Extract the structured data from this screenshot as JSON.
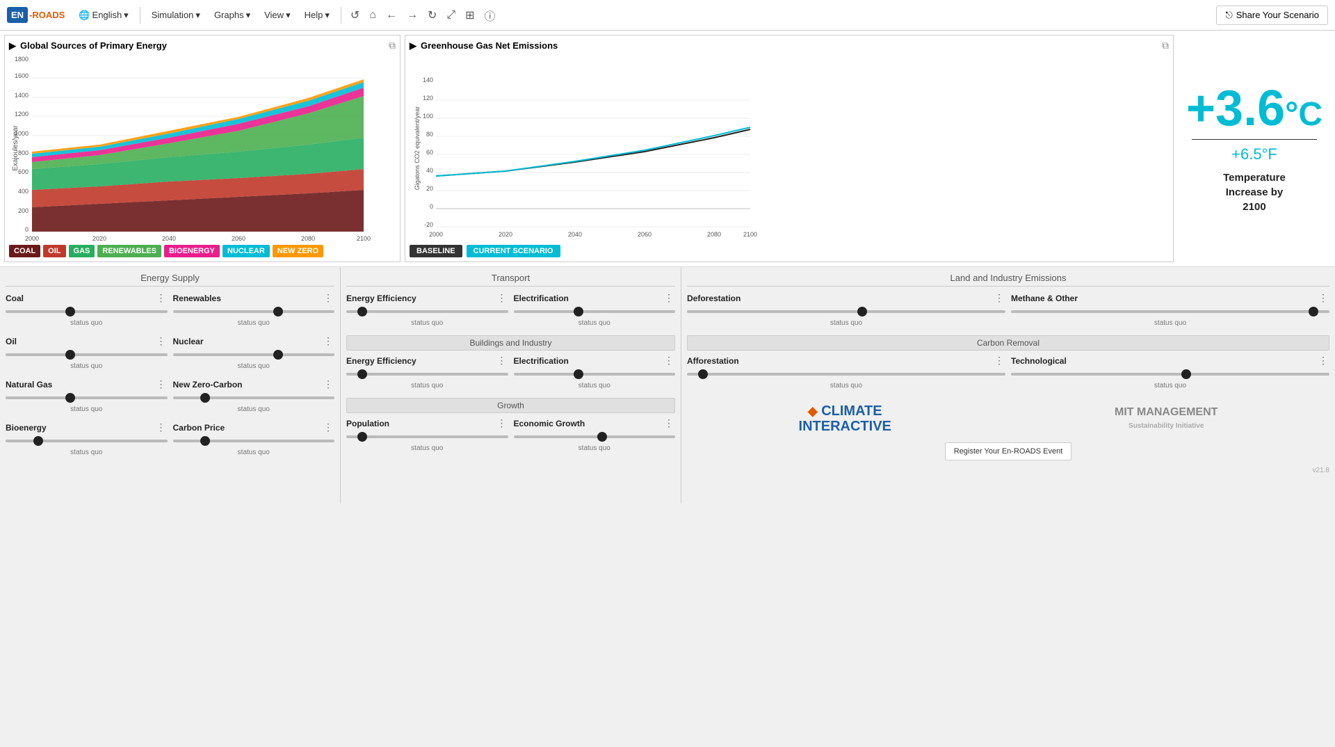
{
  "nav": {
    "logo_en": "EN",
    "logo_roads": "-ROADS",
    "language": "English",
    "menus": [
      "Simulation",
      "Graphs",
      "View",
      "Help"
    ],
    "share_label": "Share Your Scenario"
  },
  "charts": {
    "left_title": "Global Sources of Primary Energy",
    "right_title": "Greenhouse Gas Net Emissions",
    "left_y_label": "Exajoules/year",
    "right_y_label": "Gigatons CO2 equivalent/year",
    "x_ticks": [
      "2000",
      "2020",
      "2040",
      "2060",
      "2080",
      "2100"
    ],
    "left_y_ticks": [
      "0",
      "200",
      "400",
      "600",
      "800",
      "1000",
      "1200",
      "1400",
      "1600",
      "1800"
    ],
    "right_y_ticks": [
      "-20",
      "0",
      "20",
      "40",
      "60",
      "80",
      "100",
      "120",
      "140"
    ],
    "legend_items": [
      {
        "label": "COAL",
        "color": "#6b1a1a"
      },
      {
        "label": "OIL",
        "color": "#c0392b"
      },
      {
        "label": "GAS",
        "color": "#27ae60"
      },
      {
        "label": "RENEWABLES",
        "color": "#2ecc71"
      },
      {
        "label": "BIOENERGY",
        "color": "#e91e8c"
      },
      {
        "label": "NUCLEAR",
        "color": "#00bcd4"
      },
      {
        "label": "NEW ZERO",
        "color": "#ff9800"
      }
    ],
    "baseline_label": "BASELINE",
    "current_label": "CURRENT SCENARIO"
  },
  "temperature": {
    "celsius": "+3.6",
    "celsius_unit": "°C",
    "fahrenheit": "+6.5°F",
    "label_line1": "Temperature",
    "label_line2": "Increase by",
    "label_line3": "2100"
  },
  "energy_supply": {
    "title": "Energy Supply",
    "controls": [
      {
        "label": "Coal",
        "position": 40,
        "status": "status quo"
      },
      {
        "label": "Renewables",
        "position": 65,
        "status": "status quo"
      },
      {
        "label": "Oil",
        "position": 40,
        "status": "status quo"
      },
      {
        "label": "Nuclear",
        "position": 65,
        "status": "status quo"
      },
      {
        "label": "Natural Gas",
        "position": 40,
        "status": "status quo"
      },
      {
        "label": "New Zero-Carbon",
        "position": 20,
        "status": "status quo"
      },
      {
        "label": "Bioenergy",
        "position": 20,
        "status": "status quo"
      },
      {
        "label": "Carbon Price",
        "position": 20,
        "status": "status quo"
      }
    ]
  },
  "transport": {
    "title": "Transport",
    "controls": [
      {
        "label": "Energy Efficiency",
        "position": 10,
        "status": "status quo"
      },
      {
        "label": "Electrification",
        "position": 40,
        "status": "status quo"
      }
    ],
    "buildings_title": "Buildings and Industry",
    "buildings_controls": [
      {
        "label": "Energy Efficiency",
        "position": 10,
        "status": "status quo"
      },
      {
        "label": "Electrification",
        "position": 40,
        "status": "status quo"
      }
    ],
    "growth_title": "Growth",
    "growth_controls": [
      {
        "label": "Population",
        "position": 10,
        "status": "status quo"
      },
      {
        "label": "Economic Growth",
        "position": 55,
        "status": "status quo"
      }
    ]
  },
  "land_industry": {
    "title": "Land and Industry Emissions",
    "controls": [
      {
        "label": "Deforestation",
        "position": 55,
        "status": "status quo"
      },
      {
        "label": "Methane & Other",
        "position": 95,
        "status": "status quo"
      }
    ],
    "carbon_title": "Carbon Removal",
    "carbon_controls": [
      {
        "label": "Afforestation",
        "position": 5,
        "status": "status quo"
      },
      {
        "label": "Technological",
        "position": 55,
        "status": "status quo"
      }
    ]
  },
  "footer": {
    "register_label": "Register Your En-ROADS Event",
    "version": "v21.8",
    "climate_logo_line1": "CLIMATE",
    "climate_logo_line2": "INTERACTIVE",
    "mit_label": "MIT MANAGEMENT"
  },
  "icons": {
    "triangle": "▶",
    "copy": "⧉",
    "globe": "🌐",
    "chevron": "▾",
    "undo": "↺",
    "home": "⌂",
    "back": "←",
    "forward": "→",
    "refresh": "↻",
    "resize": "⤢",
    "grid": "⊞",
    "info": "ⓘ",
    "share": "⎋",
    "dots": "⋮"
  }
}
